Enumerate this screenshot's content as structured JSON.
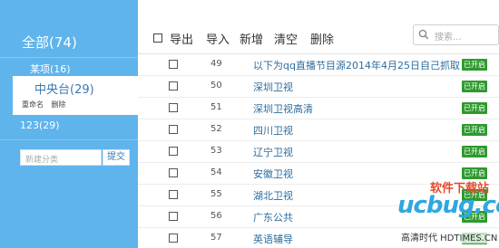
{
  "sidebar": {
    "title": "全部(74)",
    "items": [
      {
        "label": "某项(16)"
      },
      {
        "label": "中央台(29)"
      },
      {
        "label": "123(29)"
      }
    ],
    "active_actions": {
      "rename": "重命名",
      "delete": "删除"
    },
    "new_category_placeholder": "新建分类",
    "submit_label": "提交"
  },
  "toolbar": {
    "export_label": "导出",
    "import_label": "导入",
    "add_label": "新增",
    "clear_label": "清空",
    "delete_label": "删除",
    "search_placeholder": "搜索..."
  },
  "channels": [
    {
      "id": "49",
      "name": "以下为qq直播节目源2014年4月25日自己抓取",
      "status": "已开启"
    },
    {
      "id": "50",
      "name": "深圳卫视",
      "status": "已开启"
    },
    {
      "id": "51",
      "name": "深圳卫视高清",
      "status": "已开启"
    },
    {
      "id": "52",
      "name": "四川卫视",
      "status": "已开启"
    },
    {
      "id": "53",
      "name": "辽宁卫视",
      "status": "已开启"
    },
    {
      "id": "54",
      "name": "安徽卫视",
      "status": "已开启"
    },
    {
      "id": "55",
      "name": "湖北卫视",
      "status": "已开启"
    },
    {
      "id": "56",
      "name": "广东公共",
      "status": "已开启"
    },
    {
      "id": "57",
      "name": "英语辅导",
      "status": "已开启"
    }
  ],
  "colors": {
    "accent": "#5fb4ec",
    "status_on": "#2e9a2e",
    "link": "#2d6d9e"
  },
  "watermark": {
    "title": "软件下载站",
    "logo": "ucbug.cc",
    "site": "高清时代 HDTIMES.CN"
  }
}
